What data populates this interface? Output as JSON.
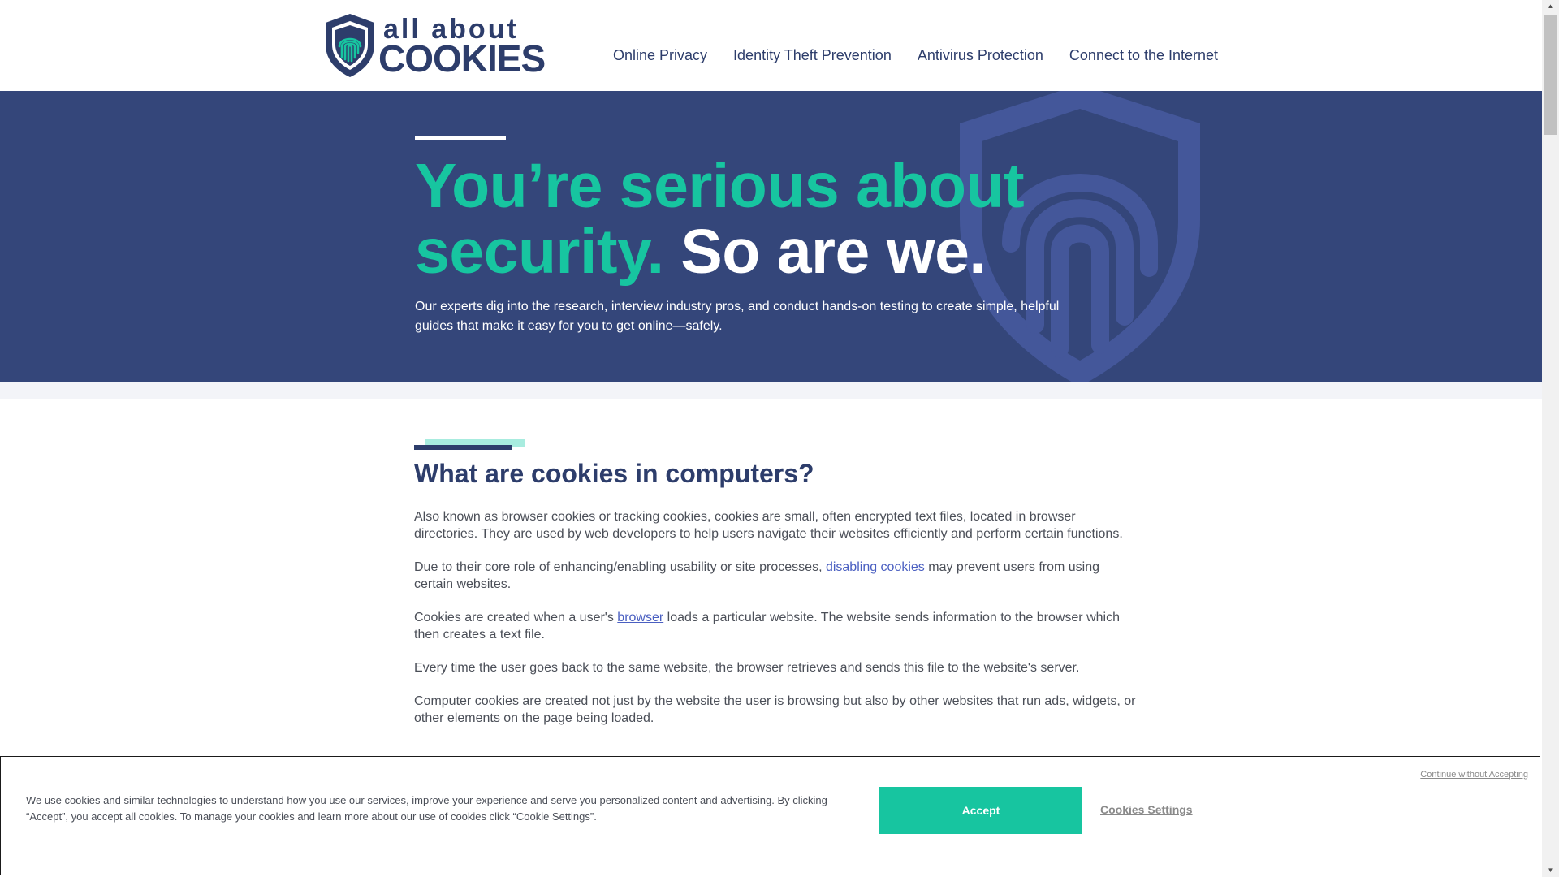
{
  "brand": {
    "logo_top": "all about",
    "logo_bottom": "COOKIES",
    "logo_icon": "fingerprint-shield-icon"
  },
  "nav": {
    "items": [
      {
        "label": "Online Privacy"
      },
      {
        "label": "Identity Theft Prevention"
      },
      {
        "label": "Antivirus Protection"
      },
      {
        "label": "Connect to the Internet"
      }
    ]
  },
  "hero": {
    "headline_teal": "You’re serious about security.",
    "headline_white": "So are we.",
    "subtext": "Our experts dig into the research, interview industry pros, and conduct hands-on testing to create simple, helpful guides that make it easy for you to get online—safely.",
    "background_icon": "fingerprint-shield-icon"
  },
  "article": {
    "title": "What are cookies in computers?",
    "p1": "Also known as browser cookies or tracking cookies, cookies are small, often encrypted text files, located in browser directories. They are used by web developers to help users navigate their websites efficiently and perform certain functions.",
    "p2_before": "Due to their core role of enhancing/enabling usability or site processes, ",
    "p2_link": "disabling cookies",
    "p2_after": " may prevent users from using certain websites.",
    "p3_before": "Cookies are created when a user's ",
    "p3_link": "browser",
    "p3_after": " loads a particular website. The website sends information to the browser which then creates a text file.",
    "p4": "Every time the user goes back to the same website, the browser retrieves and sends this file to the website's server.",
    "p5": "Computer cookies are created not just by the website the user is browsing but also by other websites that run ads, widgets, or other elements on the page being loaded."
  },
  "cookie_banner": {
    "continue_label": "Continue without Accepting",
    "text": "We use cookies and similar technologies to understand how you use our services, improve your experience and serve you personalized content and advertising. By clicking “Accept”, you accept all cookies. To manage your cookies and learn more about our use of cookies click “Cookie Settings”.",
    "accept_label": "Accept",
    "settings_label": "Cookies Settings"
  },
  "colors": {
    "navy": "#2d3d6b",
    "hero_bg": "#34467a",
    "teal": "#17c5a0",
    "link": "#4a5fc1"
  }
}
